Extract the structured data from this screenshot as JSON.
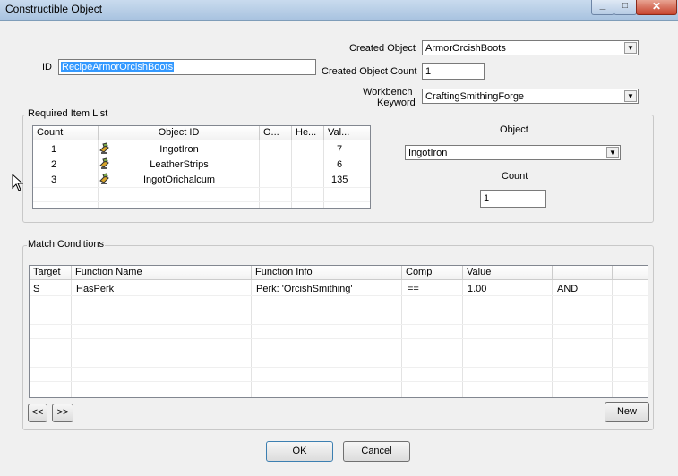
{
  "window": {
    "title": "Constructible Object"
  },
  "id_label": "ID",
  "id_value": "RecipeArmorOrcishBoots",
  "created_object": {
    "label": "Created Object",
    "value": "ArmorOrcishBoots"
  },
  "created_object_count": {
    "label": "Created Object Count",
    "value": "1"
  },
  "workbench": {
    "label_line1": "Workbench",
    "label_line2": "Keyword",
    "value": "CraftingSmithingForge"
  },
  "required": {
    "title": "Required Item List",
    "columns": [
      "Count",
      "Object ID",
      "O...",
      "He...",
      "Val..."
    ],
    "rows": [
      {
        "count": "1",
        "object_id": "IngotIron",
        "val": "7"
      },
      {
        "count": "2",
        "object_id": "LeatherStrips",
        "val": "6"
      },
      {
        "count": "3",
        "object_id": "IngotOrichalcum",
        "val": "135"
      }
    ],
    "object_label": "Object",
    "object_value": "IngotIron",
    "count_label": "Count",
    "count_value": "1"
  },
  "match": {
    "title": "Match Conditions",
    "columns": [
      "Target",
      "Function Name",
      "Function Info",
      "Comp",
      "Value",
      ""
    ],
    "rows": [
      {
        "target": "S",
        "function": "HasPerk",
        "info": "Perk: 'OrcishSmithing'",
        "comp": "==",
        "value": "1.00",
        "logic": "AND"
      }
    ],
    "prev_label": "<<",
    "next_label": ">>",
    "new_label": "New"
  },
  "buttons": {
    "ok": "OK",
    "cancel": "Cancel"
  },
  "icons": {
    "dropdown": "chevron-down-icon",
    "item": "recipe-item-icon",
    "cursor": "mouse-cursor-icon"
  }
}
